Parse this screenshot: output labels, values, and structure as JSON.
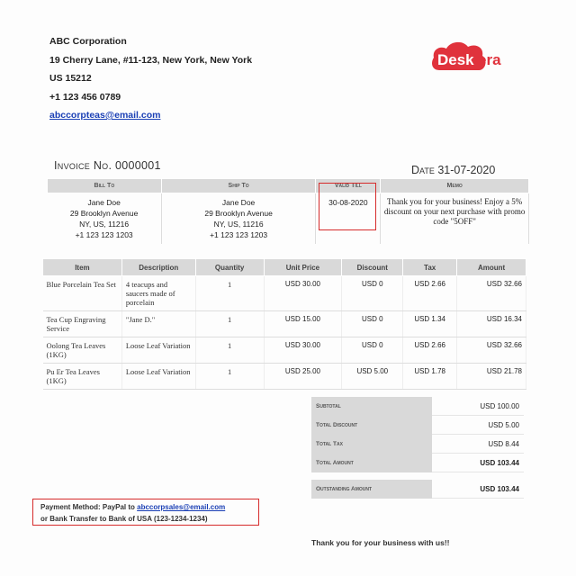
{
  "company": {
    "name": "ABC Corporation",
    "address1": "19 Cherry Lane, #11-123,  New York, New York",
    "address2": "US 15212",
    "phone": "+1 123 456 0789",
    "email": "abccorpteas@email.com"
  },
  "logo": {
    "text_red": "Desk",
    "text_dark": "era",
    "brand_color": "#e0323c"
  },
  "invoice": {
    "number_label": "Invoice No. 0000001",
    "date_label": "Date 31-07-2020"
  },
  "info_headers": [
    "Bill To",
    "Ship To",
    "Valid Till",
    "Memo"
  ],
  "bill_to": [
    "Jane Doe",
    "29 Brooklyn Avenue",
    "NY, US, 11216",
    "+1 123 123 1203"
  ],
  "ship_to": [
    "Jane Doe",
    "29 Brooklyn Avenue",
    "NY, US, 11216",
    "+1 123 123 1203"
  ],
  "valid_till": "30-08-2020",
  "memo": "Thank you for your business! Enjoy a 5% discount on your next purchase with promo code \"5OFF\"",
  "item_headers": [
    "Item",
    "Description",
    "Quantity",
    "Unit Price",
    "Discount",
    "Tax",
    "Amount"
  ],
  "items": [
    [
      "Blue Porcelain Tea Set",
      "4 teacups and saucers made of porcelain",
      "1",
      "USD 30.00",
      "USD 0",
      "USD 2.66",
      "USD 32.66"
    ],
    [
      "Tea Cup Engraving Service",
      "\"Jane D.\"",
      "1",
      "USD 15.00",
      "USD 0",
      "USD 1.34",
      "USD 16.34"
    ],
    [
      "Oolong Tea Leaves (1KG)",
      "Loose Leaf Variation",
      "1",
      "USD 30.00",
      "USD 0",
      "USD 2.66",
      "USD 32.66"
    ],
    [
      "Pu Er Tea Leaves (1KG)",
      "Loose Leaf Variation",
      "1",
      "USD 25.00",
      "USD 5.00",
      "USD 1.78",
      "USD 21.78"
    ]
  ],
  "totals": {
    "subtotal_label": "Subtotal",
    "subtotal": "USD 100.00",
    "discount_label": "Total Discount",
    "discount": "USD 5.00",
    "tax_label": "Total Tax",
    "tax": "USD 8.44",
    "amount_label": "Total Amount",
    "amount": "USD 103.44",
    "outstanding_label": "Outstanding Amount",
    "outstanding": "USD 103.44"
  },
  "payment": {
    "line1_prefix": "Payment Method: PayPal to ",
    "line1_email": "abccorpsales@email.com",
    "line2": "or Bank Transfer to Bank of USA (123-1234-1234)"
  },
  "thanks": "Thank you for your business with us!!",
  "colors": {
    "highlight": "#d62b2b",
    "link": "#1a3fb5",
    "header_bg": "#d9d9d9"
  }
}
